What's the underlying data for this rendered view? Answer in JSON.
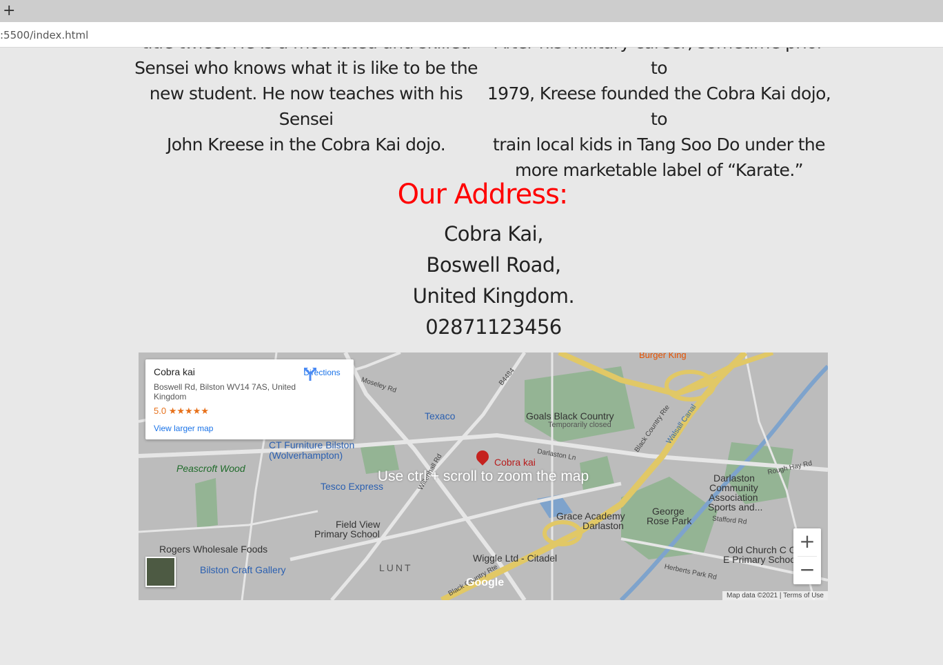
{
  "browser": {
    "new_tab_symbol": "+",
    "url": ":5500/index.html"
  },
  "bio": {
    "left_lines": [
      "title twice. He is a motivated and skilled",
      "Sensei who knows what it is like to be the",
      "new student. He now teaches with his Sensei",
      "John Kreese in the Cobra Kai dojo."
    ],
    "right_lines": [
      "After his military career, sometime prior to",
      "1979, Kreese founded the Cobra Kai dojo, to",
      "train local kids in Tang Soo Do under the",
      "more marketable label of “Karate.”"
    ]
  },
  "address": {
    "title": "Our Address:",
    "line1": "Cobra Kai,",
    "line2": "Boswell Road,",
    "line3": "United Kingdom.",
    "phone": "02871123456"
  },
  "map": {
    "overlay_message": "Use ctrl + scroll to zoom the map",
    "info_card": {
      "title": "Cobra kai",
      "address": "Boswell Rd, Bilston WV14 7AS, United Kingdom",
      "rating": "5.0",
      "stars": "★★★★★",
      "view_larger": "View larger map",
      "directions": "Directions"
    },
    "places": {
      "burger_king": "Burger King",
      "texaco": "Texaco",
      "goals": "Goals Black Country",
      "goals_status": "Temporarily closed",
      "ct_furniture_1": "CT Furniture Bilston",
      "ct_furniture_2": "(Wolverhampton)",
      "peascroft": "Peascroft Wood",
      "cobra_kai": "Cobra kai",
      "tesco": "Tesco Express",
      "darlaston_1": "Darlaston",
      "darlaston_2": "Community",
      "darlaston_3": "Association",
      "darlaston_4": "Sports and...",
      "george_1": "George",
      "george_2": "Rose Park",
      "grace_1": "Grace Academy",
      "grace_2": "Darlaston",
      "fieldview_1": "Field View",
      "fieldview_2": "Primary School",
      "rogers": "Rogers Wholesale Foods",
      "bilston_craft": "Bilston Craft Gallery",
      "lunt": "LUNT",
      "wiggle": "Wiggle Ltd - Citadel",
      "old_church_1": "Old Church C O",
      "old_church_2": "E Primary Schoo"
    },
    "roads": {
      "moseley": "Moseley Rd",
      "darlaston_ln": "Darlaston Ln",
      "black_country": "Black Country Rte",
      "walsall_canal": "Walsall Canal",
      "a4484": "B4484",
      "black_country_2": "Black Country Rte",
      "rough_hay": "Rough Hay Rd",
      "willenhall": "Willenhall Rd",
      "stafford": "Stafford Rd",
      "herberts": "Herberts Park Rd"
    },
    "zoom_in": "+",
    "zoom_out": "−",
    "google_logo": "Google",
    "attribution": "Map data ©2021",
    "terms": "Terms of Use"
  },
  "colors": {
    "page_bg": "#e8e8e8",
    "heading_red": "#ff0000",
    "text_dark": "#222222",
    "map_link_blue": "#1a73e8",
    "rating_orange": "#e7711b"
  }
}
